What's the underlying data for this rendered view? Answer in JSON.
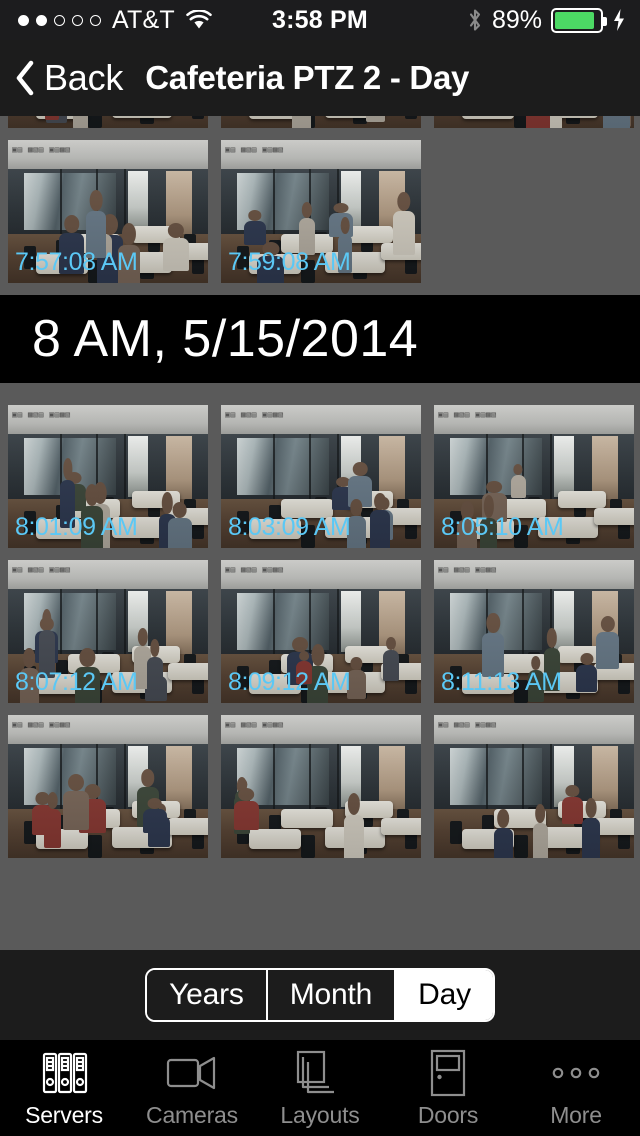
{
  "status_bar": {
    "signal_dots_filled": 2,
    "signal_dots_total": 5,
    "carrier": "AT&T",
    "wifi_icon": "wifi-icon",
    "time": "3:58 PM",
    "bluetooth_icon": "bluetooth-icon",
    "battery_percent": "89%",
    "battery_level": 89,
    "battery_color": "#4cd964",
    "charging_icon": "lightning-bolt-icon"
  },
  "nav_bar": {
    "back_icon": "chevron-left-icon",
    "back_label": "Back",
    "title": "Cafeteria PTZ 2 - Day"
  },
  "timeline": {
    "accent_timestamp_color": "#5bc8f5",
    "grid_background": "#5a5a5a",
    "sections": [
      {
        "header": null,
        "rows": [
          {
            "cells": [
              {
                "timestamp": "",
                "partial": true
              },
              {
                "timestamp": "",
                "partial": true
              },
              {
                "timestamp": "",
                "partial": true
              }
            ]
          },
          {
            "cells": [
              {
                "timestamp": "7:57:08 AM",
                "partial": false
              },
              {
                "timestamp": "7:59:08 AM",
                "partial": false
              },
              {
                "timestamp": "",
                "empty": true
              }
            ]
          }
        ]
      },
      {
        "header": "8 AM, 5/15/2014",
        "rows": [
          {
            "cells": [
              {
                "timestamp": "8:01:09 AM",
                "partial": false
              },
              {
                "timestamp": "8:03:09 AM",
                "partial": false
              },
              {
                "timestamp": "8:05:10 AM",
                "partial": false
              }
            ]
          },
          {
            "cells": [
              {
                "timestamp": "8:07:12 AM",
                "partial": false
              },
              {
                "timestamp": "8:09:12 AM",
                "partial": false
              },
              {
                "timestamp": "8:11:13 AM",
                "partial": false
              }
            ]
          },
          {
            "cells": [
              {
                "timestamp": "",
                "partial": true
              },
              {
                "timestamp": "",
                "partial": true
              },
              {
                "timestamp": "",
                "partial": true
              }
            ]
          }
        ]
      }
    ]
  },
  "toolbar": {
    "segments": [
      {
        "label": "Years",
        "selected": false
      },
      {
        "label": "Month",
        "selected": false
      },
      {
        "label": "Day",
        "selected": true
      }
    ]
  },
  "tab_bar": {
    "tabs": [
      {
        "label": "Servers",
        "icon": "server-rack-icon",
        "selected": true
      },
      {
        "label": "Cameras",
        "icon": "video-camera-icon",
        "selected": false
      },
      {
        "label": "Layouts",
        "icon": "stacked-pages-icon",
        "selected": false
      },
      {
        "label": "Doors",
        "icon": "door-icon",
        "selected": false
      },
      {
        "label": "More",
        "icon": "ellipsis-icon",
        "selected": false
      }
    ]
  }
}
